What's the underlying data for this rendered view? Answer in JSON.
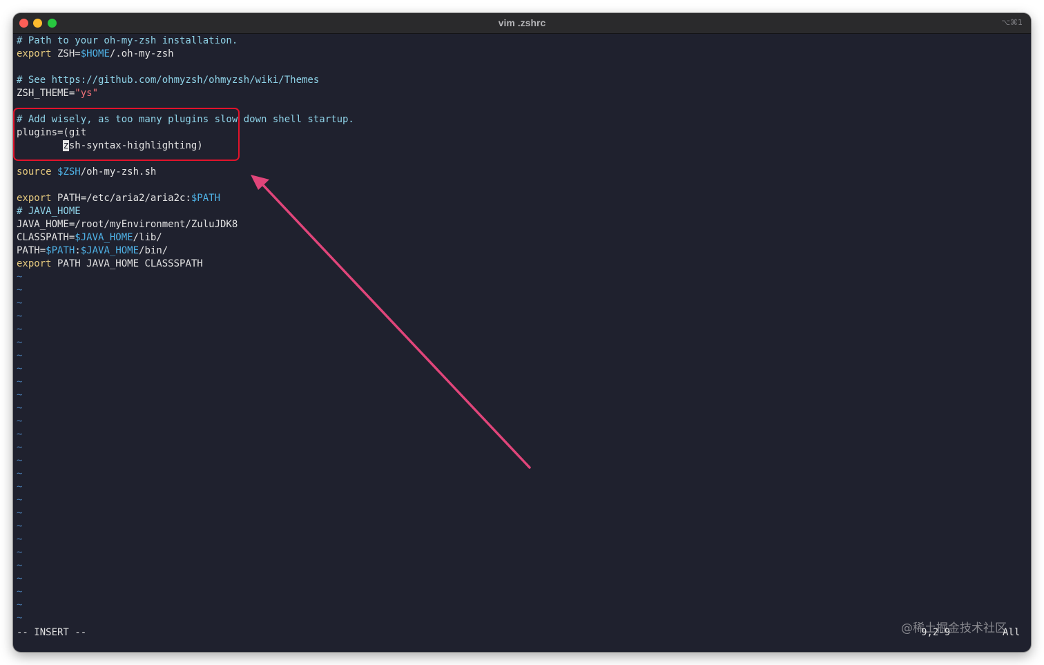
{
  "window": {
    "title": "vim .zshrc",
    "shortcut": "⌥⌘1"
  },
  "editor": {
    "lines": [
      {
        "segments": [
          {
            "text": "# Path to your oh-my-zsh installation.",
            "kind": "comment"
          }
        ]
      },
      {
        "segments": [
          {
            "text": "export",
            "kind": "kw"
          },
          {
            "text": " ZSH=",
            "kind": "plain"
          },
          {
            "text": "$HOME",
            "kind": "var"
          },
          {
            "text": "/.oh-my-zsh",
            "kind": "plain"
          }
        ]
      },
      {
        "segments": []
      },
      {
        "segments": [
          {
            "text": "# See https://github.com/ohmyzsh/ohmyzsh/wiki/Themes",
            "kind": "comment"
          }
        ]
      },
      {
        "segments": [
          {
            "text": "ZSH_THEME=",
            "kind": "plain"
          },
          {
            "text": "\"ys\"",
            "kind": "str"
          }
        ]
      },
      {
        "segments": []
      },
      {
        "segments": [
          {
            "text": "# Add wisely, as too many plugins slow down shell startup.",
            "kind": "comment"
          }
        ]
      },
      {
        "segments": [
          {
            "text": "plugins=(git",
            "kind": "plain"
          }
        ]
      },
      {
        "segments": [
          {
            "text": "        ",
            "kind": "plain"
          },
          {
            "text": "z",
            "kind": "cursor"
          },
          {
            "text": "sh-syntax-highlighting)",
            "kind": "plain"
          }
        ]
      },
      {
        "segments": []
      },
      {
        "segments": [
          {
            "text": "source",
            "kind": "kw"
          },
          {
            "text": " ",
            "kind": "plain"
          },
          {
            "text": "$ZSH",
            "kind": "var"
          },
          {
            "text": "/oh-my-zsh.sh",
            "kind": "plain"
          }
        ]
      },
      {
        "segments": []
      },
      {
        "segments": [
          {
            "text": "export",
            "kind": "kw"
          },
          {
            "text": " PATH=/etc/aria2/aria2c:",
            "kind": "plain"
          },
          {
            "text": "$PATH",
            "kind": "var"
          }
        ]
      },
      {
        "segments": [
          {
            "text": "# JAVA_HOME",
            "kind": "comment"
          }
        ]
      },
      {
        "segments": [
          {
            "text": "JAVA_HOME=/root/myEnvironment/ZuluJDK8",
            "kind": "plain"
          }
        ]
      },
      {
        "segments": [
          {
            "text": "CLASSPATH=",
            "kind": "plain"
          },
          {
            "text": "$JAVA_HOME",
            "kind": "var"
          },
          {
            "text": "/lib/",
            "kind": "plain"
          }
        ]
      },
      {
        "segments": [
          {
            "text": "PATH=",
            "kind": "plain"
          },
          {
            "text": "$PATH",
            "kind": "var"
          },
          {
            "text": ":",
            "kind": "plain"
          },
          {
            "text": "$JAVA_HOME",
            "kind": "var"
          },
          {
            "text": "/bin/",
            "kind": "plain"
          }
        ]
      },
      {
        "segments": [
          {
            "text": "export",
            "kind": "kw"
          },
          {
            "text": " PATH JAVA_HOME CLASSSPATH",
            "kind": "plain"
          }
        ]
      }
    ],
    "tilde_marker": "~",
    "tilde_count": 27
  },
  "status": {
    "mode": "-- INSERT --",
    "ruler": "9,2-9",
    "scroll": "All"
  },
  "annotation": {
    "box_color": "#e2132b",
    "arrow_color": "#e0457a"
  },
  "watermark": "@稀土掘金技术社区",
  "colors": {
    "background": "#1f212e",
    "comment": "#8fd3e8",
    "keyword": "#e5c97e",
    "variable": "#4fb2e6",
    "string": "#f07178",
    "tilde": "#4a7fb5"
  }
}
